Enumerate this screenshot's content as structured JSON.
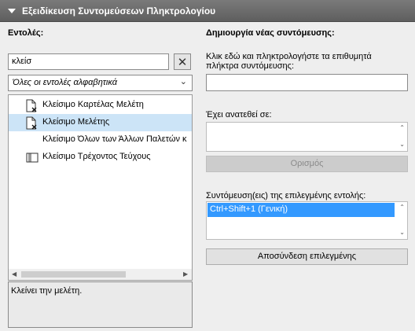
{
  "header": {
    "title": "Εξειδίκευση Συντομεύσεων Πληκτρολογίου"
  },
  "commands": {
    "label": "Εντολές:",
    "search_value": "κλείσ",
    "clear_glyph": "✕",
    "filter_value": "Όλες οι εντολές αλφαβητικά",
    "items": [
      {
        "label": "Κλείσιμο Καρτέλας Μελέτη",
        "icon": "document-close-icon",
        "selected": false
      },
      {
        "label": "Κλείσιμο Μελέτης",
        "icon": "document-close-icon",
        "selected": true
      },
      {
        "label": "Κλείσιμο Όλων των Άλλων Παλετών κ",
        "icon": "",
        "selected": false
      },
      {
        "label": "Κλείσιμο Τρέχοντος Τεύχους",
        "icon": "book-icon",
        "selected": false
      }
    ],
    "description": "Κλείνει την μελέτη."
  },
  "new_shortcut": {
    "label": "Δημιουργία νέας συντόμευσης:",
    "instruction": [
      "Κλικ εδώ και πληκτρολογήστε τα επιθυμητά",
      "πλήκτρα συντόμευσης:"
    ],
    "input_value": "",
    "assigned_label": "Έχει ανατεθεί σε:",
    "assign_button": "Ορισμός"
  },
  "shortcuts": {
    "label": "Συντόμευση(εις) της επιλεγμένης εντολής:",
    "items": [
      "Ctrl+Shift+1 (Γενική)"
    ],
    "disconnect_button": "Αποσύνδεση επιλεγμένης"
  },
  "colors": {
    "header": "#6b6b6b",
    "selection": "#cce4f7",
    "accent": "#3399ff"
  }
}
